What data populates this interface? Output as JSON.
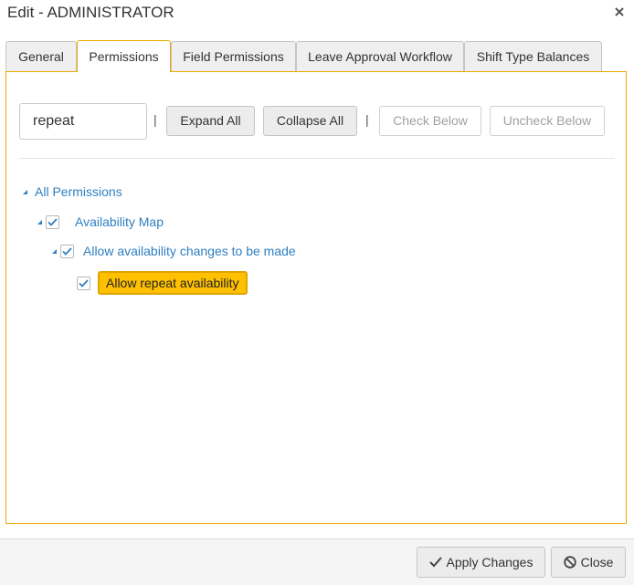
{
  "window": {
    "title": "Edit - ADMINISTRATOR",
    "close_icon": "close-icon"
  },
  "tabs": [
    {
      "label": "General",
      "active": false
    },
    {
      "label": "Permissions",
      "active": true
    },
    {
      "label": "Field Permissions",
      "active": false
    },
    {
      "label": "Leave Approval Workflow",
      "active": false
    },
    {
      "label": "Shift Type Balances",
      "active": false
    }
  ],
  "toolbar": {
    "search_value": "repeat",
    "separator": "|",
    "expand_all": "Expand All",
    "collapse_all": "Collapse All",
    "check_below": "Check Below",
    "uncheck_below": "Uncheck Below"
  },
  "tree": {
    "root": {
      "label": "All Permissions",
      "expanded": true
    },
    "items": [
      {
        "label": "Availability Map",
        "checked": true,
        "expanded": true
      },
      {
        "label": "Allow availability changes to be made",
        "checked": true,
        "expanded": true
      },
      {
        "label": "Allow repeat availability",
        "checked": true,
        "highlighted": true
      }
    ]
  },
  "footer": {
    "apply_label": "Apply Changes",
    "close_label": "Close"
  },
  "colors": {
    "accent": "#e8a900",
    "link": "#2e7fc1",
    "highlight": "#ffc000"
  }
}
